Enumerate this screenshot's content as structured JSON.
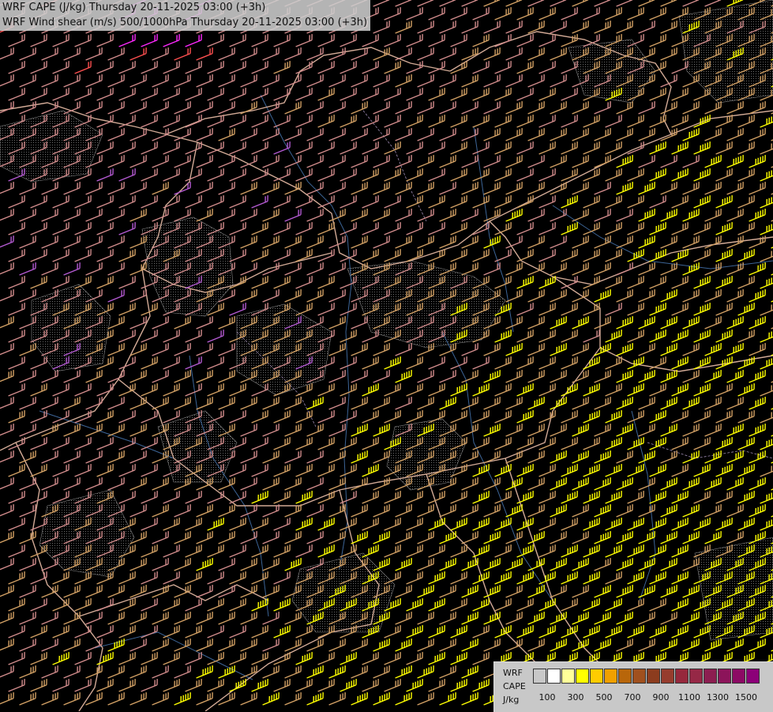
{
  "titles": {
    "line1": "WRF CAPE (J/kg) Thursday 20-11-2025 03:00 (+3h)",
    "line2": "WRF Wind shear (m/s) 500/1000hPa Thursday 20-11-2025 03:00 (+3h)"
  },
  "legend": {
    "label1": "WRF",
    "label2": "CAPE",
    "label3": "J/kg",
    "swatch_colors": [
      "#c8c8c8",
      "#ffffff",
      "#ffff99",
      "#ffff00",
      "#ffcc00",
      "#f0a000",
      "#b8660a",
      "#a0501e",
      "#8c3c1e",
      "#963c2d",
      "#96283c",
      "#962846",
      "#8c1e50",
      "#8c145a",
      "#8c0a64",
      "#8c0078"
    ],
    "ticks": [
      "100",
      "300",
      "500",
      "700",
      "900",
      "1100",
      "1300",
      "1500"
    ]
  },
  "colors": {
    "background": "#000000",
    "border_main": "#d2aa96",
    "border_minor": "#c89682",
    "river": "#3c6496",
    "barb_weak": "#d28c8c",
    "barb_mid": "#d2a064",
    "barb_strong": "#ffff00",
    "barb_violet": "#b45ad2",
    "barb_red": "#ff5050",
    "barb_magenta": "#ff28ff",
    "terrain_stipple": "#5a5a5a"
  }
}
